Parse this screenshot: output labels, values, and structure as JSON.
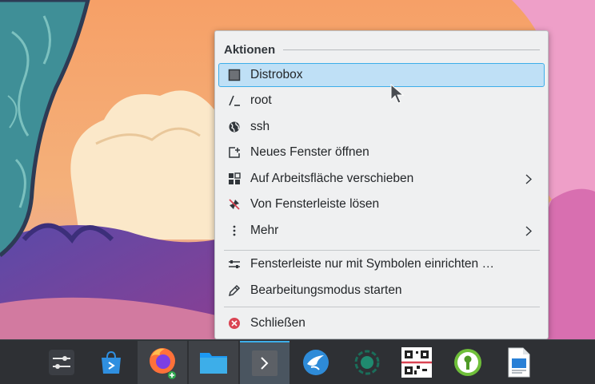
{
  "menu": {
    "section_title": "Aktionen",
    "items": [
      {
        "label": "Distrobox",
        "icon": "terminal-square-icon",
        "highlighted": true
      },
      {
        "label": "root",
        "icon": "terminal-prompt-icon"
      },
      {
        "label": "ssh",
        "icon": "globe-icon"
      },
      {
        "label": "Neues Fenster öffnen",
        "icon": "new-window-icon"
      },
      {
        "label": "Auf Arbeitsfläche verschieben",
        "icon": "virtual-desktops-icon",
        "submenu": true
      },
      {
        "label": "Von Fensterleiste lösen",
        "icon": "unpin-icon"
      },
      {
        "label": "Mehr",
        "icon": "more-vertical-icon",
        "submenu": true
      },
      {
        "label": "Fensterleiste nur mit Symbolen einrichten …",
        "icon": "configure-icon"
      },
      {
        "label": "Bearbeitungsmodus starten",
        "icon": "edit-pencil-icon"
      },
      {
        "label": "Schließen",
        "icon": "close-red-icon"
      }
    ]
  },
  "taskbar": {
    "items": [
      {
        "name": "application-launcher",
        "icon": "sliders-launcher-icon"
      },
      {
        "name": "discover-store",
        "icon": "store-bag-icon"
      },
      {
        "name": "firefox",
        "icon": "firefox-icon",
        "state": "open"
      },
      {
        "name": "file-manager",
        "icon": "folder-icon",
        "state": "open"
      },
      {
        "name": "konsole",
        "icon": "terminal-icon",
        "state": "active"
      },
      {
        "name": "kdeconnect-or-bird",
        "icon": "bird-icon"
      },
      {
        "name": "circle-app",
        "icon": "dotted-circle-icon"
      },
      {
        "name": "qr-code-app",
        "icon": "qr-code-icon"
      },
      {
        "name": "keepassxc",
        "icon": "keyhole-icon"
      },
      {
        "name": "document-viewer",
        "icon": "document-icon"
      }
    ]
  },
  "colors": {
    "menu_bg": "#eff0f1",
    "highlight_bg": "#bfe0f6",
    "highlight_border": "#3daee9",
    "panel_bg": "#2e3034",
    "close_red": "#da4453"
  }
}
